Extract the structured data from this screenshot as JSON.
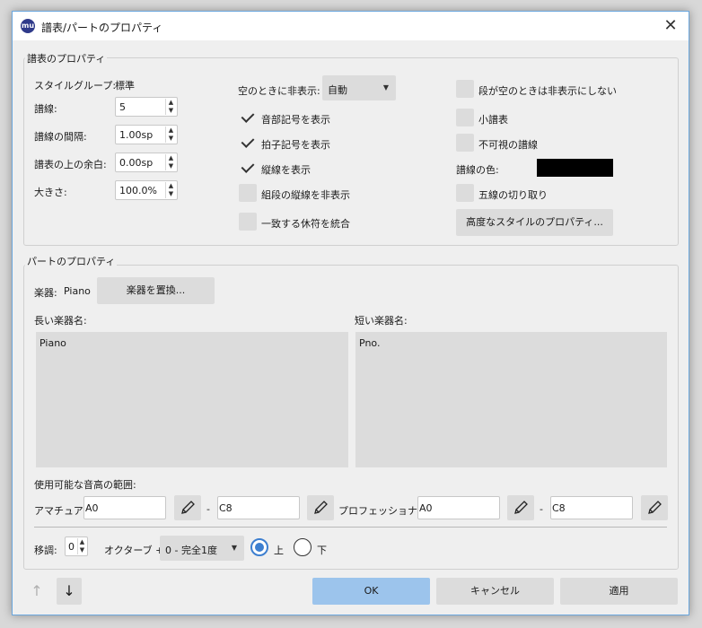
{
  "window": {
    "title": "譜表/パートのプロパティ",
    "app_icon": "musescore-icon"
  },
  "staff": {
    "group_title": "譜表のプロパティ",
    "style_group_label": "スタイルグループ:",
    "style_group_value": "標準",
    "lines_label": "譜線:",
    "lines_value": "5",
    "line_distance_label": "譜線の間隔:",
    "line_distance_value": "1.00sp",
    "extra_distance_label": "譜表の上の余白:",
    "extra_distance_value": "0.00sp",
    "scale_label": "大きさ:",
    "scale_value": "100.0%",
    "hide_when_empty_label": "空のときに非表示:",
    "hide_when_empty_value": "自動",
    "show_clef": {
      "label": "音部記号を表示",
      "checked": true
    },
    "show_timesig": {
      "label": "拍子記号を表示",
      "checked": true
    },
    "show_barlines": {
      "label": "縦線を表示",
      "checked": true
    },
    "hide_system_barline": {
      "label": "組段の縦線を非表示",
      "checked": false
    },
    "merge_rests": {
      "label": "一致する休符を統合",
      "checked": false
    },
    "dont_hide_empty": {
      "label": "段が空のときは非表示にしない",
      "checked": false
    },
    "small_staff": {
      "label": "小譜表",
      "checked": false
    },
    "invisible_lines": {
      "label": "不可視の譜線",
      "checked": false
    },
    "line_color_label": "譜線の色:",
    "line_color": "#000000",
    "cutaway": {
      "label": "五線の切り取り",
      "checked": false
    },
    "advanced_button": "高度なスタイルのプロパティ..."
  },
  "part": {
    "group_title": "パートのプロパティ",
    "instrument_label": "楽器:",
    "instrument_value": "Piano",
    "change_instrument_button": "楽器を置換...",
    "long_name_label": "長い楽器名:",
    "long_name_value": "Piano",
    "short_name_label": "短い楽器名:",
    "short_name_value": "Pno.",
    "range_label": "使用可能な音高の範囲:",
    "amateur_label": "アマチュア:",
    "amateur_low": "A0",
    "amateur_high": "C8",
    "professional_label": "プロフェッショナル:",
    "pro_low": "A0",
    "pro_high": "C8",
    "dash": "-",
    "transpose_label": "移調:",
    "transpose_octave_value": "0",
    "octave_label": "オクターブ +",
    "interval_value": "0 - 完全1度",
    "up_label": "上",
    "down_label": "下"
  },
  "footer": {
    "up_arrow": "↑",
    "down_arrow": "↓",
    "ok": "OK",
    "cancel": "キャンセル",
    "apply": "適用"
  }
}
